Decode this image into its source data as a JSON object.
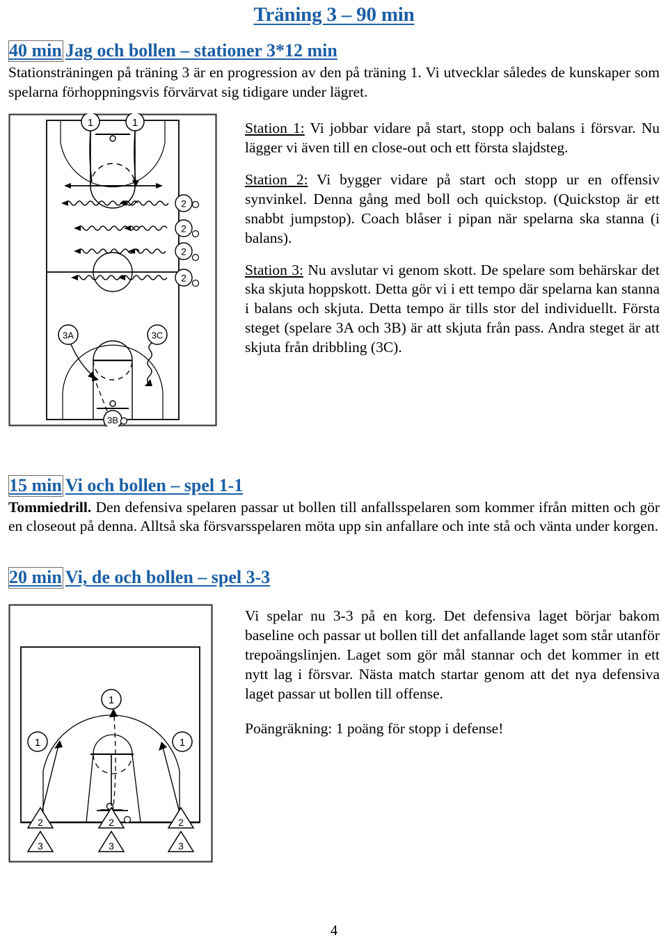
{
  "document": {
    "title": "Träning 3 – 90 min",
    "page_number": "4",
    "accent_color": "#1b5fa6",
    "text_color": "#000000",
    "background_color": "#ffffff"
  },
  "sections": [
    {
      "id": "stationer",
      "duration_label": "40 min",
      "heading": "Jag och bollen – stationer 3*12 min",
      "intro": "Stationsträningen på träning 3 är en progression av den på träning 1. Vi utvecklar således de kunskaper som spelarna förhoppningsvis förvärvat sig tidigare under lägret.",
      "paragraphs": [
        {
          "lead": "Station 1:",
          "text": " Vi jobbar vidare på start, stopp och balans i försvar. Nu lägger vi även till en close-out och ett första slajdsteg."
        },
        {
          "lead": "Station 2:",
          "text": " Vi bygger vidare på start och stopp ur en offensiv synvinkel. Denna gång med boll och quickstop. (Quickstop är ett snabbt jumpstop). Coach blåser i pipan när spelarna ska stanna (i balans)."
        },
        {
          "lead": "Station 3:",
          "text": " Nu avslutar vi genom skott. De spelare som behärskar det ska skjuta hoppskott. Detta gör vi i ett tempo där spelarna kan stanna i balans och skjuta. Detta tempo är tills stor del individuellt. Första steget (spelare 3A och 3B) är att skjuta från pass. Andra steget är att skjuta från dribbling (3C)."
        }
      ],
      "diagram": {
        "name": "full-court-stations-diagram",
        "player_labels": [
          "1",
          "1",
          "2",
          "2",
          "2",
          "2",
          "3A",
          "3C",
          "3B"
        ]
      }
    },
    {
      "id": "spel-1-1",
      "duration_label": "15 min",
      "heading": "Vi och bollen – spel 1-1",
      "lead": "Tommiedrill.",
      "text": " Den defensiva spelaren passar ut bollen till anfallsspelaren som kommer ifrån mitten och gör en closeout på denna. Alltså ska försvarsspelaren möta upp sin anfallare och inte stå och vänta under korgen."
    },
    {
      "id": "spel-3-3",
      "duration_label": "20 min",
      "heading": "Vi, de och bollen – spel 3-3",
      "paragraphs": [
        "Vi spelar nu 3-3 på en korg. Det defensiva laget börjar bakom baseline och passar ut bollen till det anfallande laget som står utanför trepoängslinjen. Laget som gör mål stannar och det kommer in ett nytt lag i försvar. Nästa match startar genom att det nya defensiva laget passar ut bollen till offense.",
        "Poängräkning: 1 poäng för stopp i defense!"
      ],
      "diagram": {
        "name": "half-court-3on3-diagram",
        "offense_labels": [
          "1",
          "1",
          "1"
        ],
        "defense_labels": [
          "2",
          "2",
          "2"
        ],
        "queue_labels": [
          "3",
          "3",
          "3"
        ]
      }
    }
  ]
}
